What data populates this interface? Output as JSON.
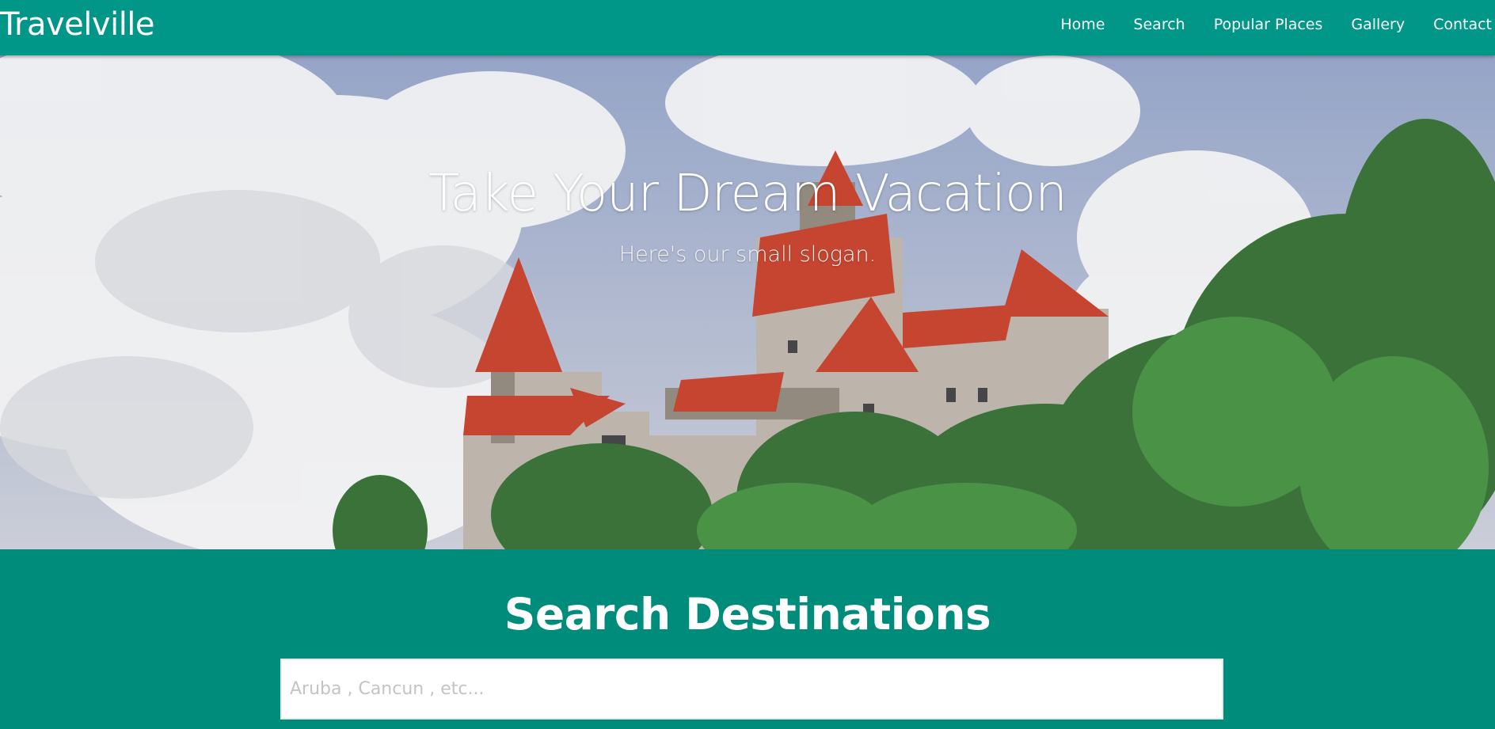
{
  "brand": "Travelville",
  "nav": {
    "items": [
      {
        "label": "Home"
      },
      {
        "label": "Search"
      },
      {
        "label": "Popular Places"
      },
      {
        "label": "Gallery"
      },
      {
        "label": "Contact"
      }
    ]
  },
  "hero": {
    "title": "Take Your Dream Vacation",
    "slogan": "Here's our small slogan.",
    "image": "castle-on-hill-photo"
  },
  "search": {
    "title": "Search Destinations",
    "placeholder": "Aruba , Cancun , etc..."
  },
  "colors": {
    "navbar": "#009688",
    "section": "#008c7a",
    "text": "#ffffff"
  }
}
